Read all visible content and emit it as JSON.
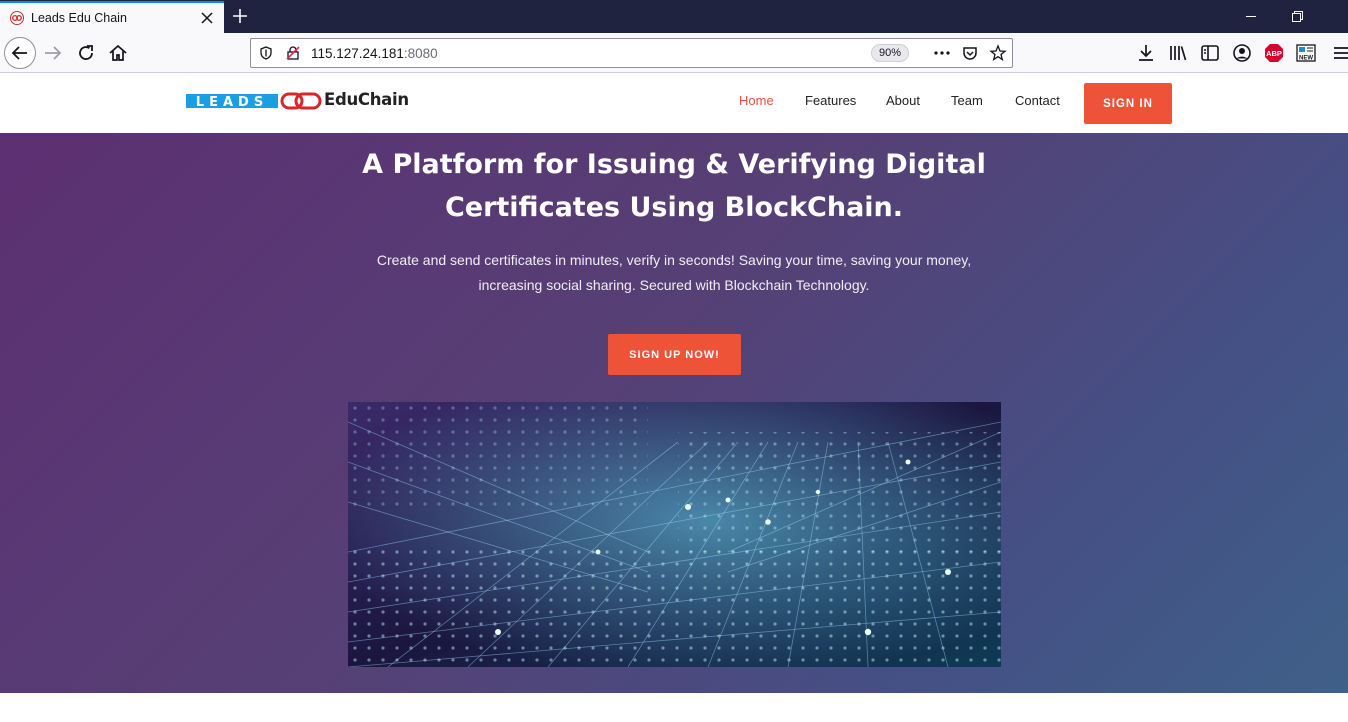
{
  "browser": {
    "tab_title": "Leads Edu Chain",
    "url_host": "115.127.24.181",
    "url_port": ":8080",
    "zoom": "90%"
  },
  "site": {
    "logo_word_1": "LEADS",
    "logo_word_2": "EduChain",
    "menu": [
      "Home",
      "Features",
      "About",
      "Team",
      "Contact"
    ],
    "signin_label": "SIGN IN"
  },
  "hero": {
    "title_line1": "A Platform for Issuing & Verifying Digital",
    "title_line2": "Certificates Using BlockChain.",
    "subtitle_line1": "Create and send certificates in minutes, verify in seconds! Saving your time, saving your money,",
    "subtitle_line2": "increasing social sharing. Secured with Blockchain Technology.",
    "cta_label": "SIGN UP NOW!"
  },
  "colors": {
    "accent": "#ee5338",
    "tab_indicator": "#0a84ff",
    "hero_gradient_start": "#5c2f72",
    "hero_gradient_end": "#3f6089"
  }
}
